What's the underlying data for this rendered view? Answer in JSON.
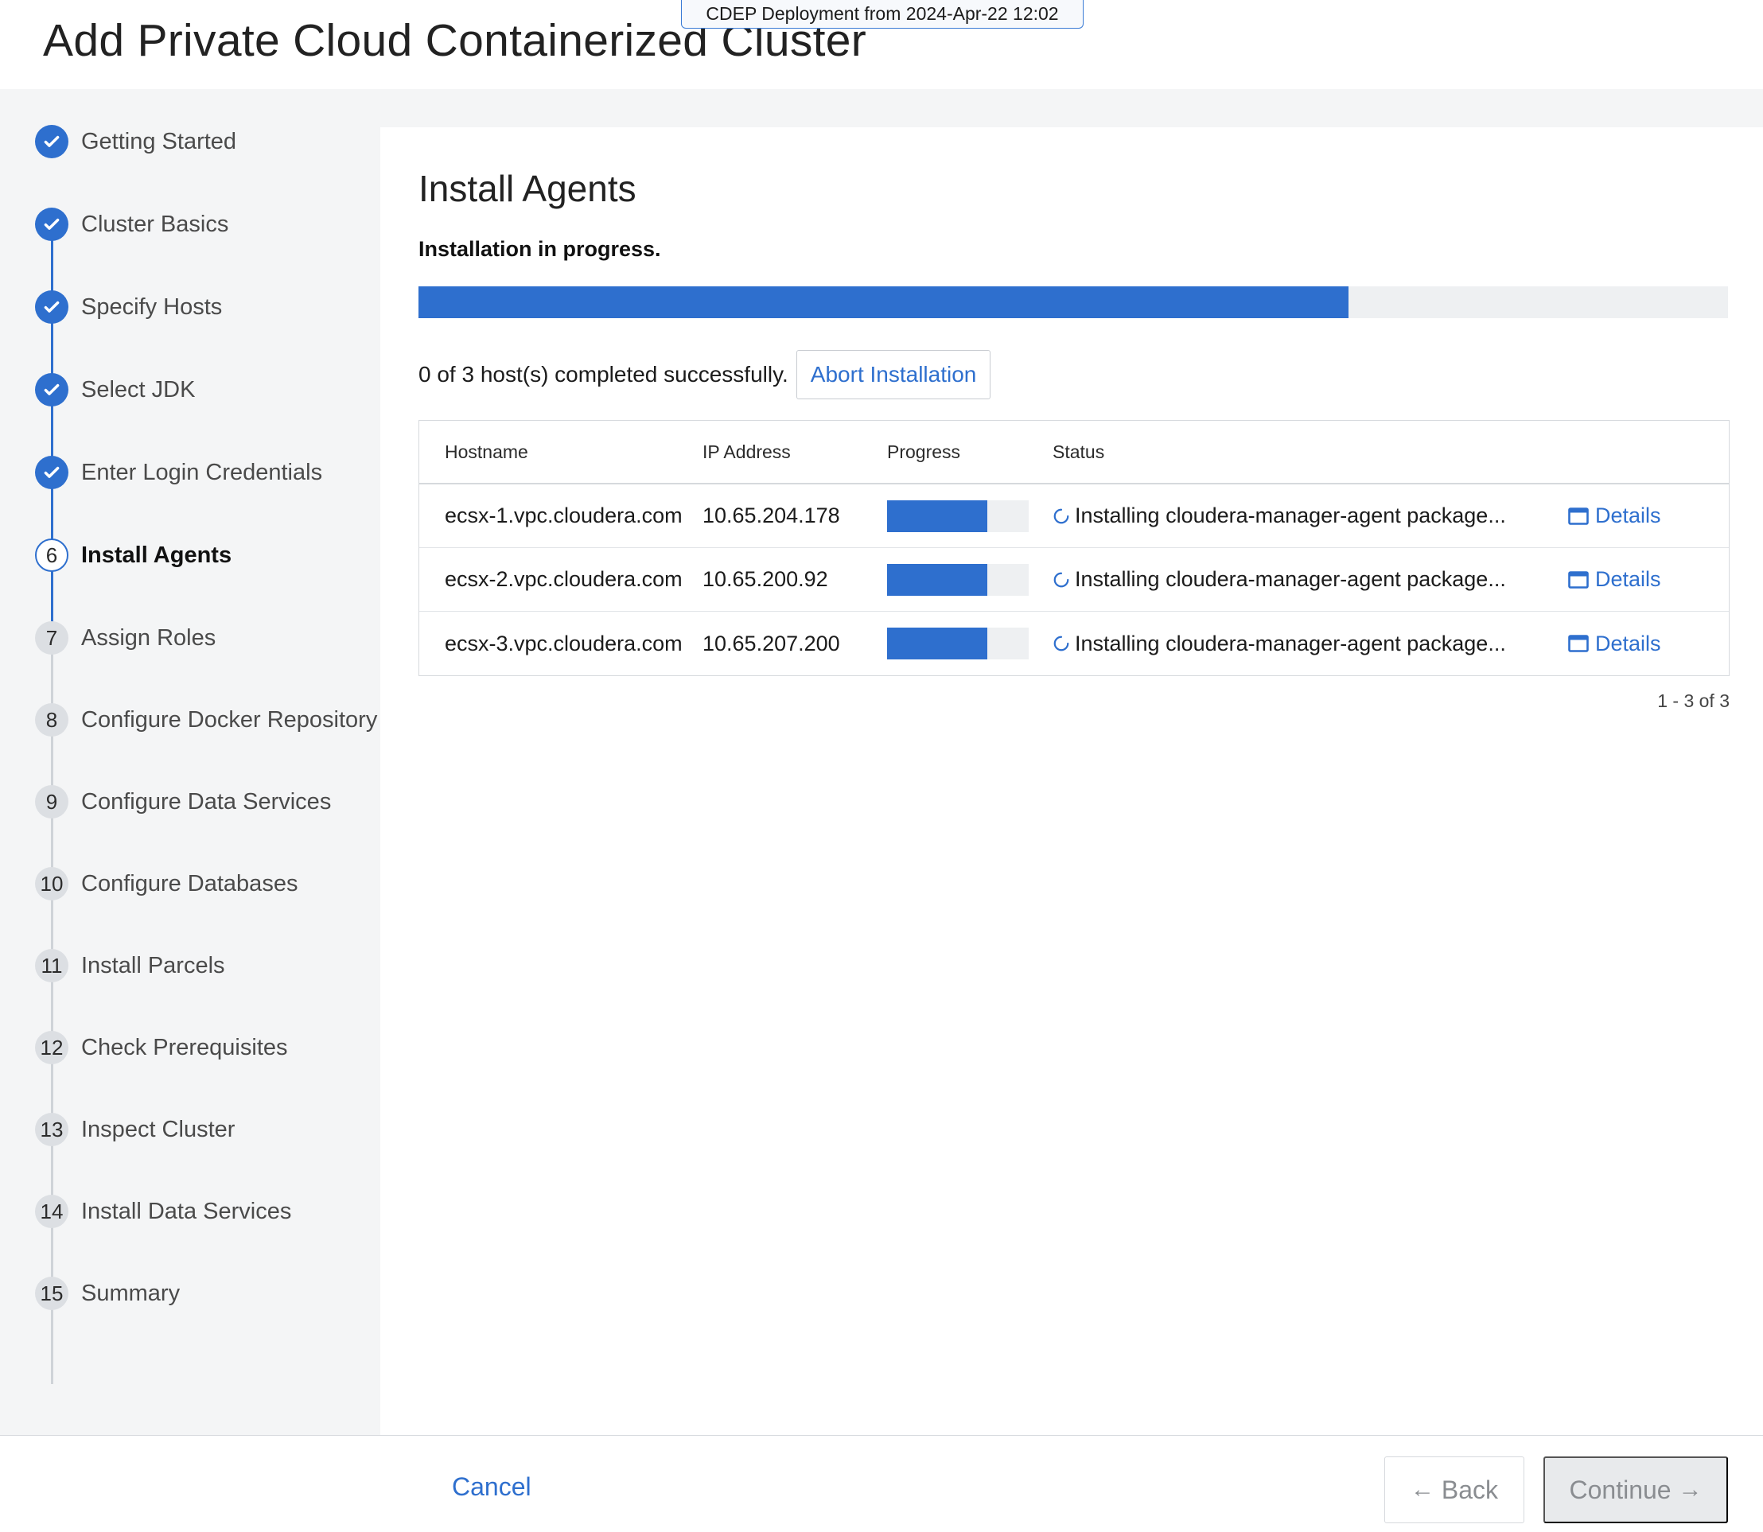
{
  "tooltip": "CDEP Deployment from 2024-Apr-22 12:02",
  "page_title": "Add Private Cloud Containerized Cluster",
  "steps": [
    {
      "marker": "",
      "label": "Getting Started",
      "state": "done"
    },
    {
      "marker": "",
      "label": "Cluster Basics",
      "state": "done"
    },
    {
      "marker": "",
      "label": "Specify Hosts",
      "state": "done"
    },
    {
      "marker": "",
      "label": "Select JDK",
      "state": "done"
    },
    {
      "marker": "",
      "label": "Enter Login Credentials",
      "state": "done"
    },
    {
      "marker": "6",
      "label": "Install Agents",
      "state": "current"
    },
    {
      "marker": "7",
      "label": "Assign Roles",
      "state": "todo"
    },
    {
      "marker": "8",
      "label": "Configure Docker Repository",
      "state": "todo"
    },
    {
      "marker": "9",
      "label": "Configure Data Services",
      "state": "todo"
    },
    {
      "marker": "10",
      "label": "Configure Databases",
      "state": "todo"
    },
    {
      "marker": "11",
      "label": "Install Parcels",
      "state": "todo"
    },
    {
      "marker": "12",
      "label": "Check Prerequisites",
      "state": "todo"
    },
    {
      "marker": "13",
      "label": "Inspect Cluster",
      "state": "todo"
    },
    {
      "marker": "14",
      "label": "Install Data Services",
      "state": "todo"
    },
    {
      "marker": "15",
      "label": "Summary",
      "state": "todo"
    }
  ],
  "main": {
    "title": "Install Agents",
    "status": "Installation in progress.",
    "overall_progress": 0.71,
    "summary": "0 of 3 host(s) completed successfully.",
    "abort_label": "Abort Installation",
    "columns": [
      "Hostname",
      "IP Address",
      "Progress",
      "Status",
      ""
    ],
    "rows": [
      {
        "hostname": "ecsx-1.vpc.cloudera.com",
        "ip": "10.65.204.178",
        "progress": 0.71,
        "status": "Installing cloudera-manager-agent package...",
        "details": "Details"
      },
      {
        "hostname": "ecsx-2.vpc.cloudera.com",
        "ip": "10.65.200.92",
        "progress": 0.71,
        "status": "Installing cloudera-manager-agent package...",
        "details": "Details"
      },
      {
        "hostname": "ecsx-3.vpc.cloudera.com",
        "ip": "10.65.207.200",
        "progress": 0.71,
        "status": "Installing cloudera-manager-agent package...",
        "details": "Details"
      }
    ],
    "pager": "1 - 3 of 3"
  },
  "footer": {
    "cancel": "Cancel",
    "back": "Back",
    "continue": "Continue"
  },
  "colors": {
    "accent": "#2e6fce",
    "progress_track": "#eef0f2",
    "band_bg": "#f4f5f6"
  },
  "icons": {
    "done_step": "check-circle-icon",
    "status": "spinner-icon",
    "details": "window-icon",
    "back": "arrow-left-icon",
    "continue": "arrow-right-icon"
  }
}
